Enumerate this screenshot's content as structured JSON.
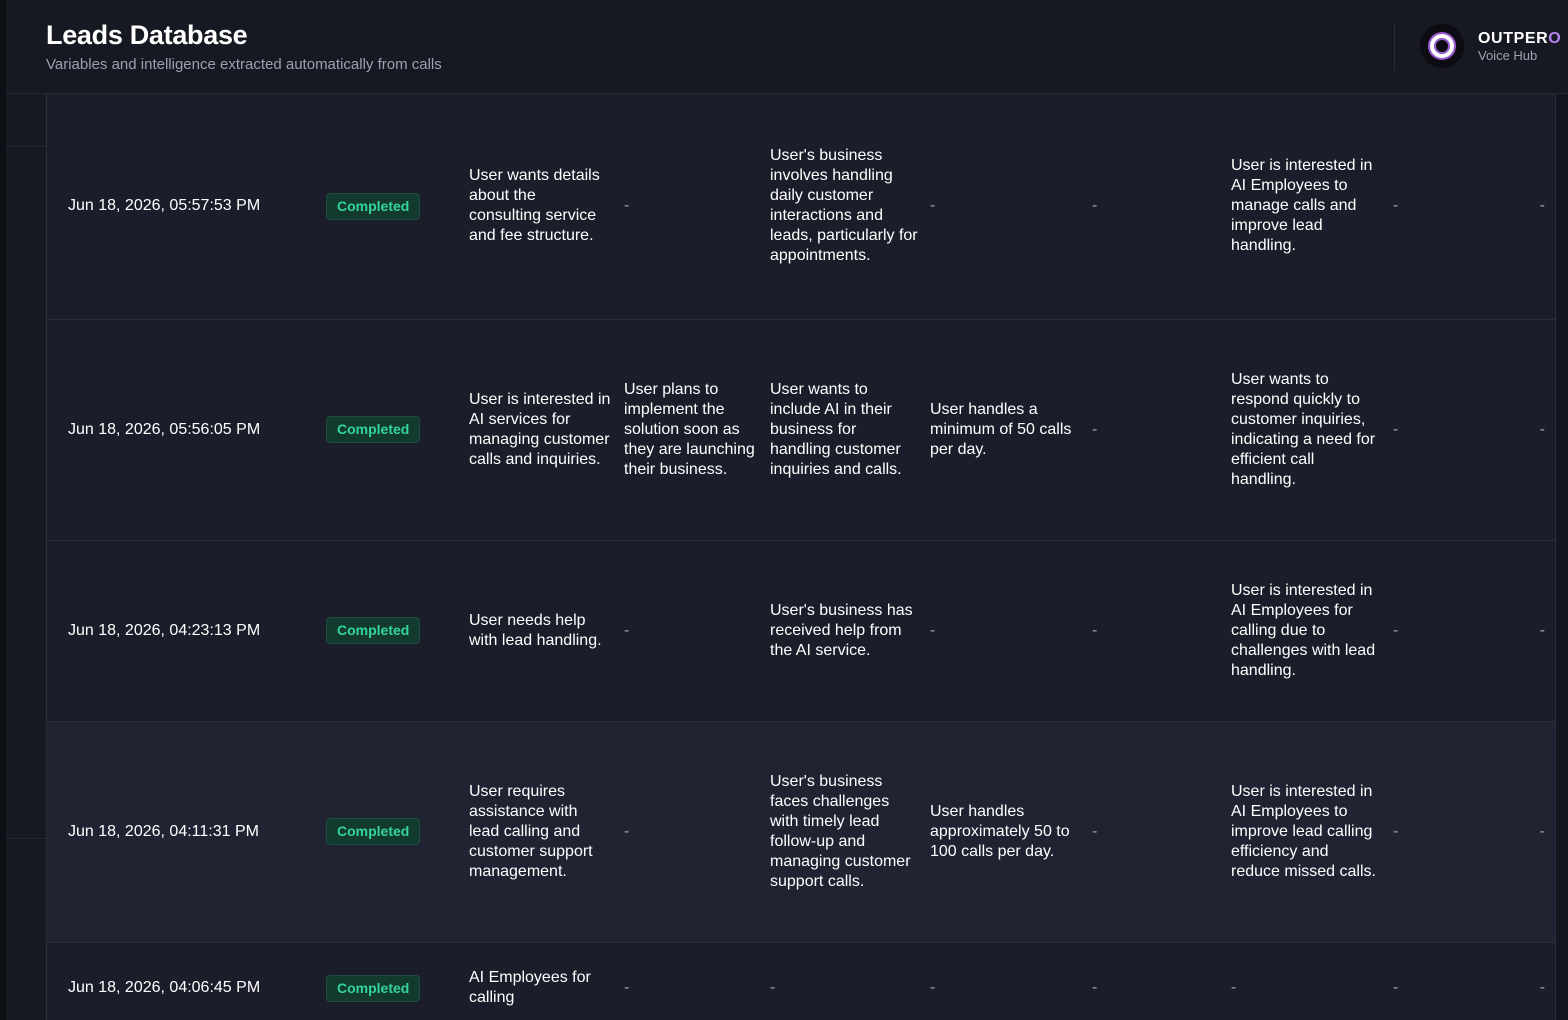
{
  "header": {
    "title": "Leads Database",
    "subtitle": "Variables and intelligence extracted automatically from calls",
    "brand_name_main": "OUTPER",
    "brand_name_accent": "O",
    "brand_sub": "Voice Hub"
  },
  "rows": [
    {
      "date": "Jun 18, 2026, 05:57:53 PM",
      "status": "Completed",
      "c1": "User wants details about the consulting service and fee structure.",
      "c2": "-",
      "c3": "User's business involves handling daily customer interactions and leads, particularly for appointments.",
      "c4": "-",
      "c5": "-",
      "c6": "User is interested in AI Employees to manage calls and improve lead handling.",
      "c7": "-",
      "c8": "-"
    },
    {
      "date": "Jun 18, 2026, 05:56:05 PM",
      "status": "Completed",
      "c1": "User is interested in AI services for managing customer calls and inquiries.",
      "c2": "User plans to implement the solution soon as they are launching their business.",
      "c3": "User wants to include AI in their business for handling customer inquiries and calls.",
      "c4": "User handles a minimum of 50 calls per day.",
      "c5": "-",
      "c6": "User wants to respond quickly to customer inquiries, indicating a need for efficient call handling.",
      "c7": "-",
      "c8": "-"
    },
    {
      "date": "Jun 18, 2026, 04:23:13 PM",
      "status": "Completed",
      "c1": "User needs help with lead handling.",
      "c2": "-",
      "c3": "User's business has received help from the AI service.",
      "c4": "-",
      "c5": "-",
      "c6": "User is interested in AI Employees for calling due to challenges with lead handling.",
      "c7": "-",
      "c8": "-"
    },
    {
      "date": "Jun 18, 2026, 04:11:31 PM",
      "status": "Completed",
      "c1": "User requires assistance with lead calling and customer support management.",
      "c2": "-",
      "c3": "User's business faces challenges with timely lead follow-up and managing customer support calls.",
      "c4": "User handles approximately 50 to 100 calls per day.",
      "c5": "-",
      "c6": "User is interested in AI Employees to improve lead calling efficiency and reduce missed calls.",
      "c7": "-",
      "c8": "-"
    },
    {
      "date": "Jun 18, 2026, 04:06:45 PM",
      "status": "Completed",
      "c1": "AI Employees for calling",
      "c2": "-",
      "c3": "-",
      "c4": "-",
      "c5": "-",
      "c6": "-",
      "c7": "-",
      "c8": "-"
    }
  ]
}
